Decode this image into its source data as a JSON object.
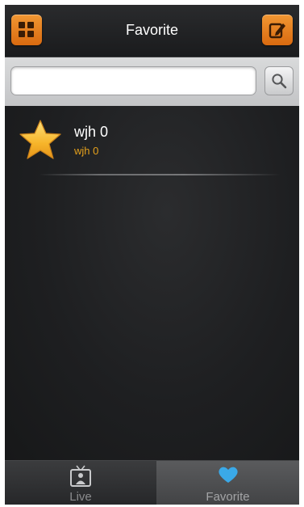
{
  "header": {
    "title": "Favorite",
    "menu_icon": "grid-icon",
    "edit_icon": "edit-icon"
  },
  "search": {
    "value": "",
    "placeholder": "",
    "button_icon": "search-icon"
  },
  "favorites": [
    {
      "title": "wjh 0",
      "subtitle": "wjh 0",
      "icon": "star-icon"
    }
  ],
  "tabs": [
    {
      "label": "Live",
      "icon": "tv-icon",
      "selected": false
    },
    {
      "label": "Favorite",
      "icon": "heart-icon",
      "selected": true
    }
  ],
  "colors": {
    "accent": "#e8821f",
    "subtitle": "#e5a11c",
    "background": "#1d1e20"
  }
}
